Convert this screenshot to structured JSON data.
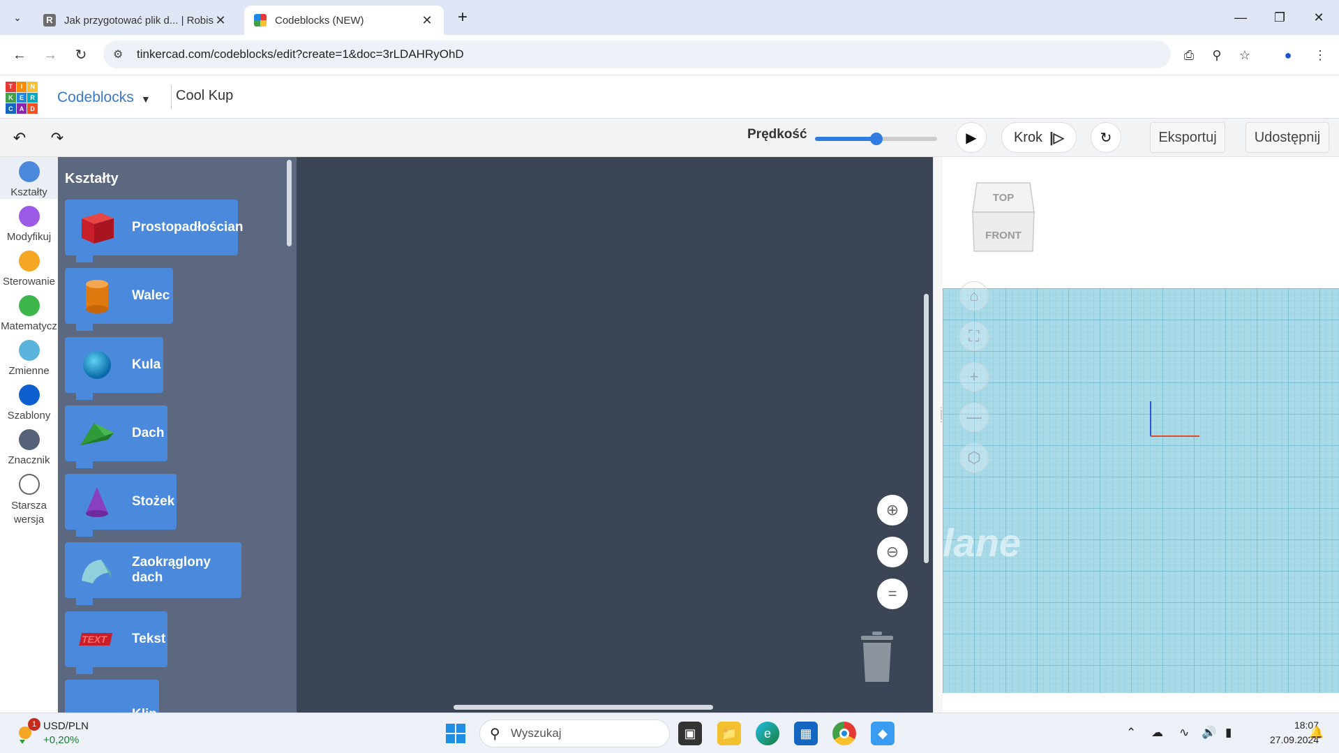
{
  "browser": {
    "tabs": [
      {
        "title": "Jak przygotować plik d... | Robis",
        "active": false,
        "icon": "robisz-favicon"
      },
      {
        "title": "Codeblocks (NEW)",
        "active": true,
        "icon": "tinkercad-favicon"
      }
    ],
    "new_tab_label": "+",
    "url": "tinkercad.com/codeblocks/edit?create=1&doc=3rLDAHRyOhD"
  },
  "app": {
    "logo_letters": [
      "T",
      "I",
      "N",
      "K",
      "E",
      "R",
      "C",
      "A",
      "D"
    ],
    "name": "Codeblocks",
    "document_name": "Cool Kup"
  },
  "toolbar": {
    "speed_label": "Prędkość",
    "speed_value": 0.5,
    "step_label": "Krok",
    "export_label": "Eksportuj",
    "share_label": "Udostępnij"
  },
  "categories": [
    {
      "label": "Kształty",
      "color": "#4a89dc",
      "selected": true
    },
    {
      "label": "Modyfikuj",
      "color": "#9b59e6"
    },
    {
      "label": "Sterowanie",
      "color": "#f5a623"
    },
    {
      "label": "Matematycz",
      "color": "#3cb54a"
    },
    {
      "label": "Zmienne",
      "color": "#5ab4dc"
    },
    {
      "label": "Szablony",
      "color": "#0d5fcf"
    },
    {
      "label": "Znacznik",
      "color": "#56627a"
    },
    {
      "label": "Starsza wersja",
      "color": "#ffffff"
    }
  ],
  "flyout": {
    "title": "Kształty",
    "blocks": [
      {
        "label": "Prostopadłościan",
        "icon": "red-box-icon"
      },
      {
        "label": "Walec",
        "icon": "orange-cylinder-icon"
      },
      {
        "label": "Kula",
        "icon": "blue-sphere-icon"
      },
      {
        "label": "Dach",
        "icon": "green-roof-icon"
      },
      {
        "label": "Stożek",
        "icon": "purple-cone-icon"
      },
      {
        "label": "Zaokrąglony dach",
        "icon": "teal-rounded-roof-icon"
      },
      {
        "label": "Tekst",
        "icon": "red-text-icon"
      },
      {
        "label": "Klin",
        "icon": "blue-wedge-icon"
      }
    ]
  },
  "viewer": {
    "viewcube_top": "TOP",
    "viewcube_front": "FRONT",
    "plane_watermark": "lane"
  },
  "taskbar": {
    "ticker_name": "USD/PLN",
    "ticker_change": "+0,20%",
    "ticker_badge": "1",
    "search_placeholder": "Wyszukaj",
    "time": "18:07",
    "date": "27.09.2024"
  }
}
